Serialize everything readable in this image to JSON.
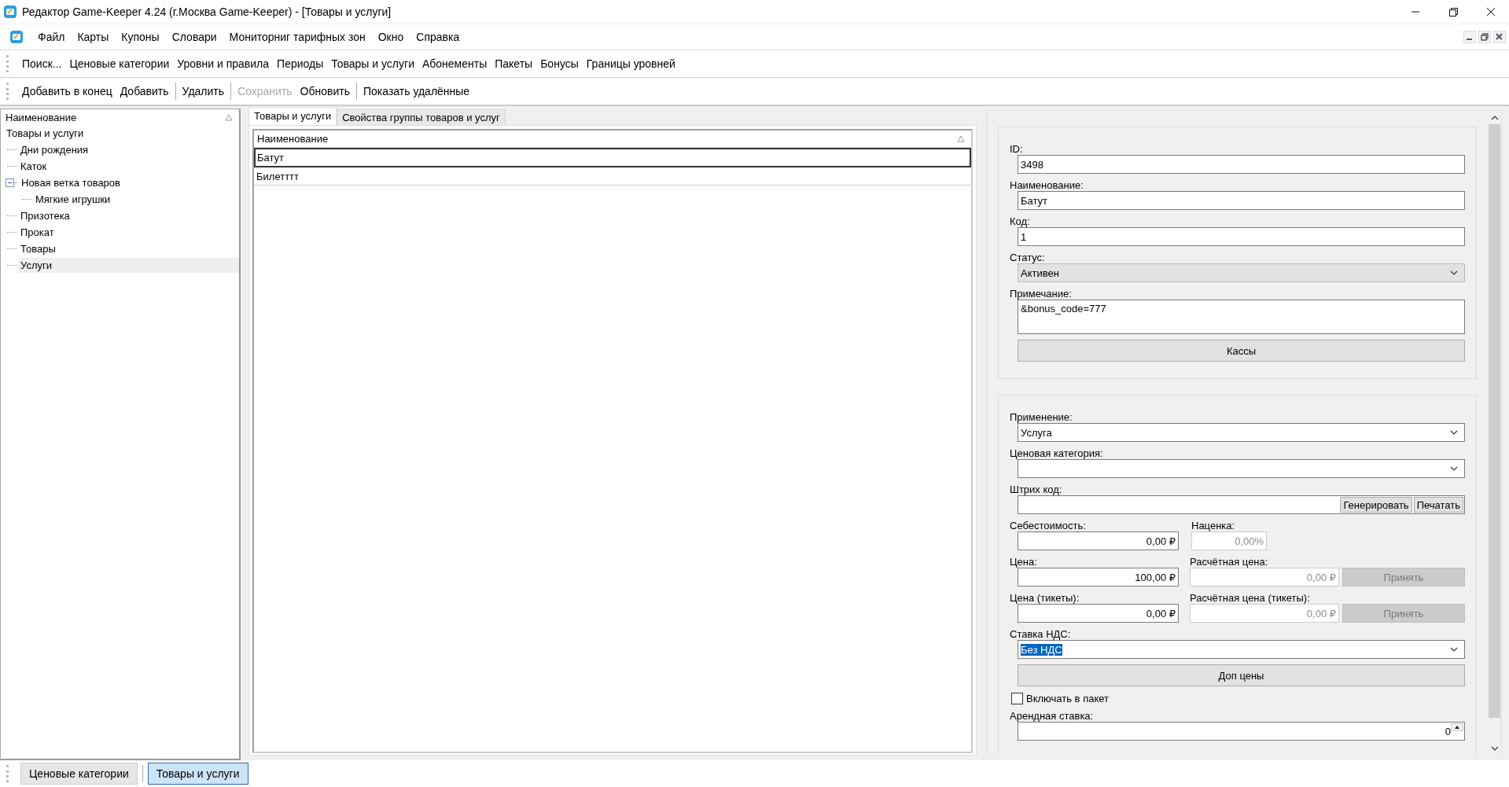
{
  "window": {
    "title": "Редактор Game-Keeper 4.24 (г.Москва Game-Keeper) - [Товары и услуги]"
  },
  "menu": [
    "Файл",
    "Карты",
    "Купоны",
    "Словари",
    "Мониторниг тарифных зон",
    "Окно",
    "Справка"
  ],
  "nav_toolbar": [
    "Поиск...",
    "Ценовые категории",
    "Уровни и правила",
    "Периоды",
    "Товары и услуги",
    "Абонементы",
    "Пакеты",
    "Бонусы",
    "Границы уровней"
  ],
  "action_toolbar": [
    [
      {
        "label": "Добавить в конец",
        "disabled": false
      },
      {
        "label": "Добавить",
        "disabled": false
      }
    ],
    [
      {
        "label": "Удалить",
        "disabled": false
      }
    ],
    [
      {
        "label": "Сохранить",
        "disabled": true
      },
      {
        "label": "Обновить",
        "disabled": false
      }
    ],
    [
      {
        "label": "Показать удалённые",
        "disabled": false
      }
    ]
  ],
  "tree": {
    "header": "Наименование",
    "items": [
      {
        "label": "Товары и услуги",
        "selected": false,
        "children": [
          {
            "label": "Дни рождения",
            "selected": false
          },
          {
            "label": "Каток",
            "selected": false
          },
          {
            "label": "Новая ветка товаров",
            "selected": false,
            "expanded": true,
            "children": [
              {
                "label": "Мягкие игрушки",
                "selected": false
              }
            ]
          },
          {
            "label": "Призотека",
            "selected": false
          },
          {
            "label": "Прокат",
            "selected": false
          },
          {
            "label": "Товары",
            "selected": false
          },
          {
            "label": "Услуги",
            "selected": true
          }
        ]
      }
    ]
  },
  "tabs": [
    {
      "label": "Товары и услуги",
      "selected": true
    },
    {
      "label": "Свойства группы товаров и услуг",
      "selected": false
    }
  ],
  "grid": {
    "columns": [
      "Наименование"
    ],
    "rows": [
      {
        "cells": [
          "Батут"
        ],
        "selected": true
      },
      {
        "cells": [
          "Билетттт"
        ],
        "selected": false
      }
    ]
  },
  "form": {
    "groups": [
      {
        "rows": [
          {
            "kind": "text",
            "label": "ID:",
            "value": "3498"
          },
          {
            "kind": "text",
            "label": "Наименование:",
            "value": "Батут"
          },
          {
            "kind": "text",
            "label": "Код:",
            "value": "1"
          },
          {
            "kind": "select",
            "label": "Статус:",
            "value": "Активен",
            "editable": false
          },
          {
            "kind": "memo",
            "label": "Примечание:",
            "value": "&bonus_code=777"
          },
          {
            "kind": "button",
            "label": "Кассы"
          }
        ]
      },
      {
        "rows": [
          {
            "kind": "select",
            "label": "Применение:",
            "value": "Услуга",
            "editable": true
          },
          {
            "kind": "select",
            "label": "Ценовая категория:",
            "editable": true
          },
          {
            "kind": "barcode",
            "label": "Штрих код:",
            "buttons": [
              "Генерировать",
              "Печатать"
            ]
          },
          {
            "kind": "pair",
            "left": {
              "label": "Себестоимость:",
              "value": "0,00 ₽"
            },
            "right": {
              "label": "Наценка:",
              "value": "0,00%",
              "disabled": true
            }
          },
          {
            "kind": "pair",
            "left": {
              "label": "Цена:",
              "value": "100,00 ₽"
            },
            "right": {
              "label": "Расчётная цена:",
              "value": "0,00 ₽",
              "disabled": true
            },
            "button": {
              "label": "Принять",
              "disabled": true
            }
          },
          {
            "kind": "pair",
            "left": {
              "label": "Цена (тикеты):",
              "value": "0,00 ₽"
            },
            "right": {
              "label": "Расчётная цена (тикеты):",
              "value": "0,00 ₽",
              "disabled": true
            },
            "button": {
              "label": "Принять",
              "disabled": true
            }
          },
          {
            "kind": "select",
            "label": "Ставка НДС:",
            "value": "Без НДС",
            "editable": true,
            "highlighted": true
          },
          {
            "kind": "button",
            "label": "Доп цены"
          },
          {
            "kind": "checkbox",
            "label": "Включать в пакет",
            "checked": false
          },
          {
            "kind": "spin",
            "label": "Арендная ставка:",
            "value": "0"
          }
        ]
      }
    ]
  },
  "window_tabs": [
    {
      "label": "Ценовые категории",
      "selected": false
    },
    {
      "label": "Товары и услуги",
      "selected": true
    }
  ]
}
